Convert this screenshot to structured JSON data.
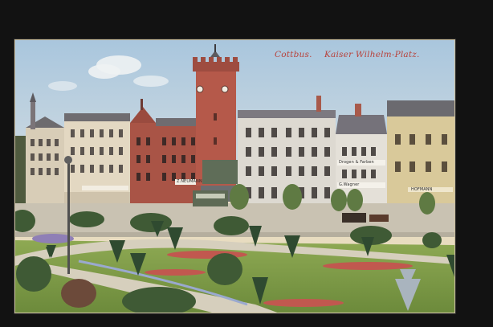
{
  "caption": {
    "city": "Cottbus.",
    "place": "Kaiser Wilhelm-Platz."
  },
  "shop_signs": {
    "left_building": "Z.NEUMANN",
    "right_building_top": "Drogen & Farben",
    "right_building_bottom": "G.Wagner",
    "far_right": "HOFMANN"
  },
  "colors": {
    "sky": "#b9cfe0",
    "brick": "#b4584a",
    "lawn": "#7f9a48",
    "caption_red": "#b8413a",
    "background": "#121212"
  }
}
